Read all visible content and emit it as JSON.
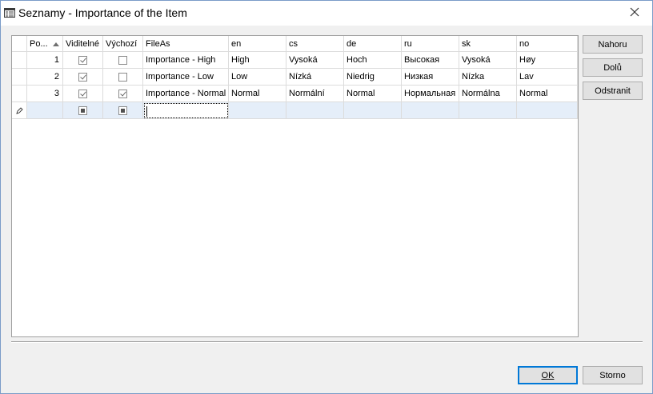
{
  "window": {
    "title": "Seznamy - Importance of the Item"
  },
  "grid": {
    "columns": [
      "Po...",
      "Viditelné",
      "Výchozí",
      "FileAs",
      "en",
      "cs",
      "de",
      "ru",
      "sk",
      "no"
    ],
    "rows": [
      {
        "pos": "1",
        "visible": true,
        "default": false,
        "fileas": "Importance - High",
        "en": "High",
        "cs": "Vysoká",
        "de": "Hoch",
        "ru": "Высокая",
        "sk": "Vysoká",
        "no": "Høy"
      },
      {
        "pos": "2",
        "visible": true,
        "default": false,
        "fileas": "Importance - Low",
        "en": "Low",
        "cs": "Nízká",
        "de": "Niedrig",
        "ru": "Низкая",
        "sk": "Nízka",
        "no": "Lav"
      },
      {
        "pos": "3",
        "visible": true,
        "default": true,
        "fileas": "Importance - Normal",
        "en": "Normal",
        "cs": "Normální",
        "de": "Normal",
        "ru": "Нормальная",
        "sk": "Normálna",
        "no": "Normal"
      }
    ],
    "new_row": {
      "fileas": ""
    }
  },
  "side_buttons": {
    "up": "Nahoru",
    "down": "Dolů",
    "remove": "Odstranit"
  },
  "footer": {
    "ok": "OK",
    "cancel": "Storno"
  },
  "colors": {
    "accent": "#0078d7",
    "new_row_bg": "#e5eef9",
    "window_bg": "#f0f0f0"
  }
}
